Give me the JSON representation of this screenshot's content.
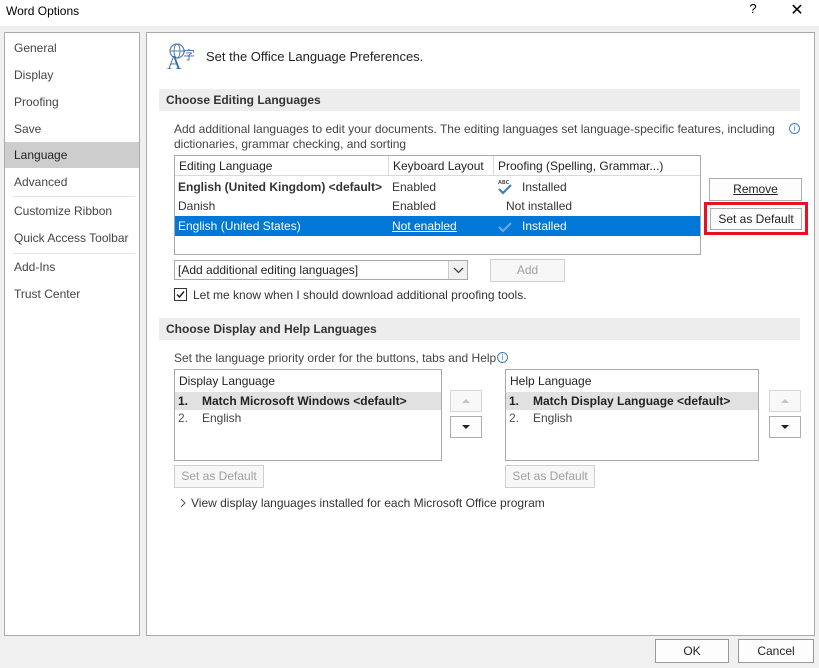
{
  "window": {
    "title": "Word Options",
    "help_glyph": "?",
    "close_glyph": "✕"
  },
  "sidebar": {
    "items": [
      {
        "label": "General"
      },
      {
        "label": "Display"
      },
      {
        "label": "Proofing"
      },
      {
        "label": "Save"
      },
      {
        "label": "Language",
        "selected": true
      },
      {
        "label": "Advanced"
      },
      {
        "label": "Customize Ribbon"
      },
      {
        "label": "Quick Access Toolbar"
      },
      {
        "label": "Add-Ins"
      },
      {
        "label": "Trust Center"
      }
    ]
  },
  "header": {
    "title": "Set the Office Language Preferences.",
    "icon": "language-icon"
  },
  "editing": {
    "section_title": "Choose Editing Languages",
    "description_line1": "Add additional languages to edit your documents. The editing languages set language-specific features, including",
    "description_line2": "dictionaries, grammar checking, and sorting",
    "columns": [
      "Editing Language",
      "Keyboard Layout",
      "Proofing (Spelling, Grammar...)"
    ],
    "rows": [
      {
        "language": "English (United Kingdom) <default>",
        "keyboard": "Enabled",
        "proofing": "Installed",
        "bold": true
      },
      {
        "language": "Danish",
        "keyboard": "Enabled",
        "proofing": "Not installed"
      },
      {
        "language": "English (United States)",
        "keyboard": "Not enabled",
        "proofing": "Installed",
        "selected": true
      }
    ],
    "remove_label": "Remove",
    "set_default_label": "Set as Default",
    "add_dropdown_value": "[Add additional editing languages]",
    "add_label": "Add",
    "notify_checkbox_label": "Let me know when I should download additional proofing tools.",
    "notify_checked": true
  },
  "display_help": {
    "section_title": "Choose Display and Help Languages",
    "description": "Set the language priority order for the buttons, tabs and Help",
    "display_list": {
      "header": "Display Language",
      "items": [
        {
          "num": "1.",
          "label": "Match Microsoft Windows <default>"
        },
        {
          "num": "2.",
          "label": "English"
        }
      ]
    },
    "help_list": {
      "header": "Help Language",
      "items": [
        {
          "num": "1.",
          "label": "Match Display Language <default>"
        },
        {
          "num": "2.",
          "label": "English"
        }
      ]
    },
    "set_default_label": "Set as Default",
    "view_link": "View display languages installed for each Microsoft Office program"
  },
  "footer": {
    "ok_label": "OK",
    "cancel_label": "Cancel"
  },
  "colors": {
    "selection": "#0078d7",
    "highlight_box": "#e81123",
    "check_blue": "#3c7fc1"
  }
}
